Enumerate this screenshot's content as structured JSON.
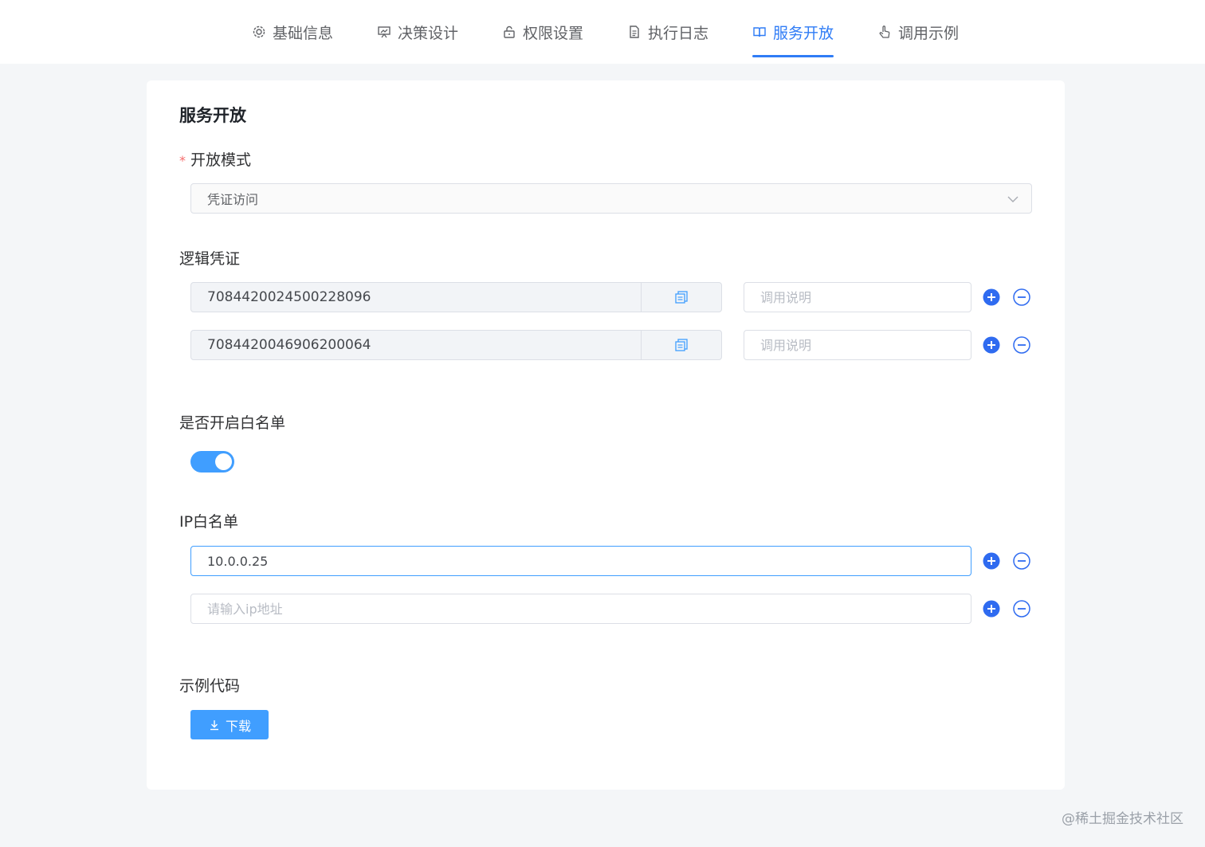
{
  "tabs": [
    {
      "label": "基础信息",
      "icon": "gear-icon",
      "active": false
    },
    {
      "label": "决策设计",
      "icon": "presentation-icon",
      "active": false
    },
    {
      "label": "权限设置",
      "icon": "lock-icon",
      "active": false
    },
    {
      "label": "执行日志",
      "icon": "document-icon",
      "active": false
    },
    {
      "label": "服务开放",
      "icon": "book-icon",
      "active": true
    },
    {
      "label": "调用示例",
      "icon": "pointer-icon",
      "active": false
    }
  ],
  "colors": {
    "accent": "#2f7cf6",
    "primary": "#409eff",
    "required": "#f56c6c"
  },
  "card": {
    "title": "服务开放",
    "open_mode": {
      "required_mark": "*",
      "label": "开放模式",
      "value": "凭证访问"
    },
    "credentials": {
      "label": "逻辑凭证",
      "items": [
        {
          "value": "7084420024500228096",
          "note_placeholder": "调用说明"
        },
        {
          "value": "7084420046906200064",
          "note_placeholder": "调用说明"
        }
      ]
    },
    "whitelist_toggle": {
      "label": "是否开启白名单",
      "enabled": true
    },
    "ip_whitelist": {
      "label": "IP白名单",
      "items": [
        {
          "value": "10.0.0.25",
          "placeholder": "请输入ip地址"
        },
        {
          "value": "",
          "placeholder": "请输入ip地址"
        }
      ]
    },
    "sample_code": {
      "label": "示例代码",
      "download_label": "下载"
    }
  },
  "watermark": "@稀土掘金技术社区"
}
